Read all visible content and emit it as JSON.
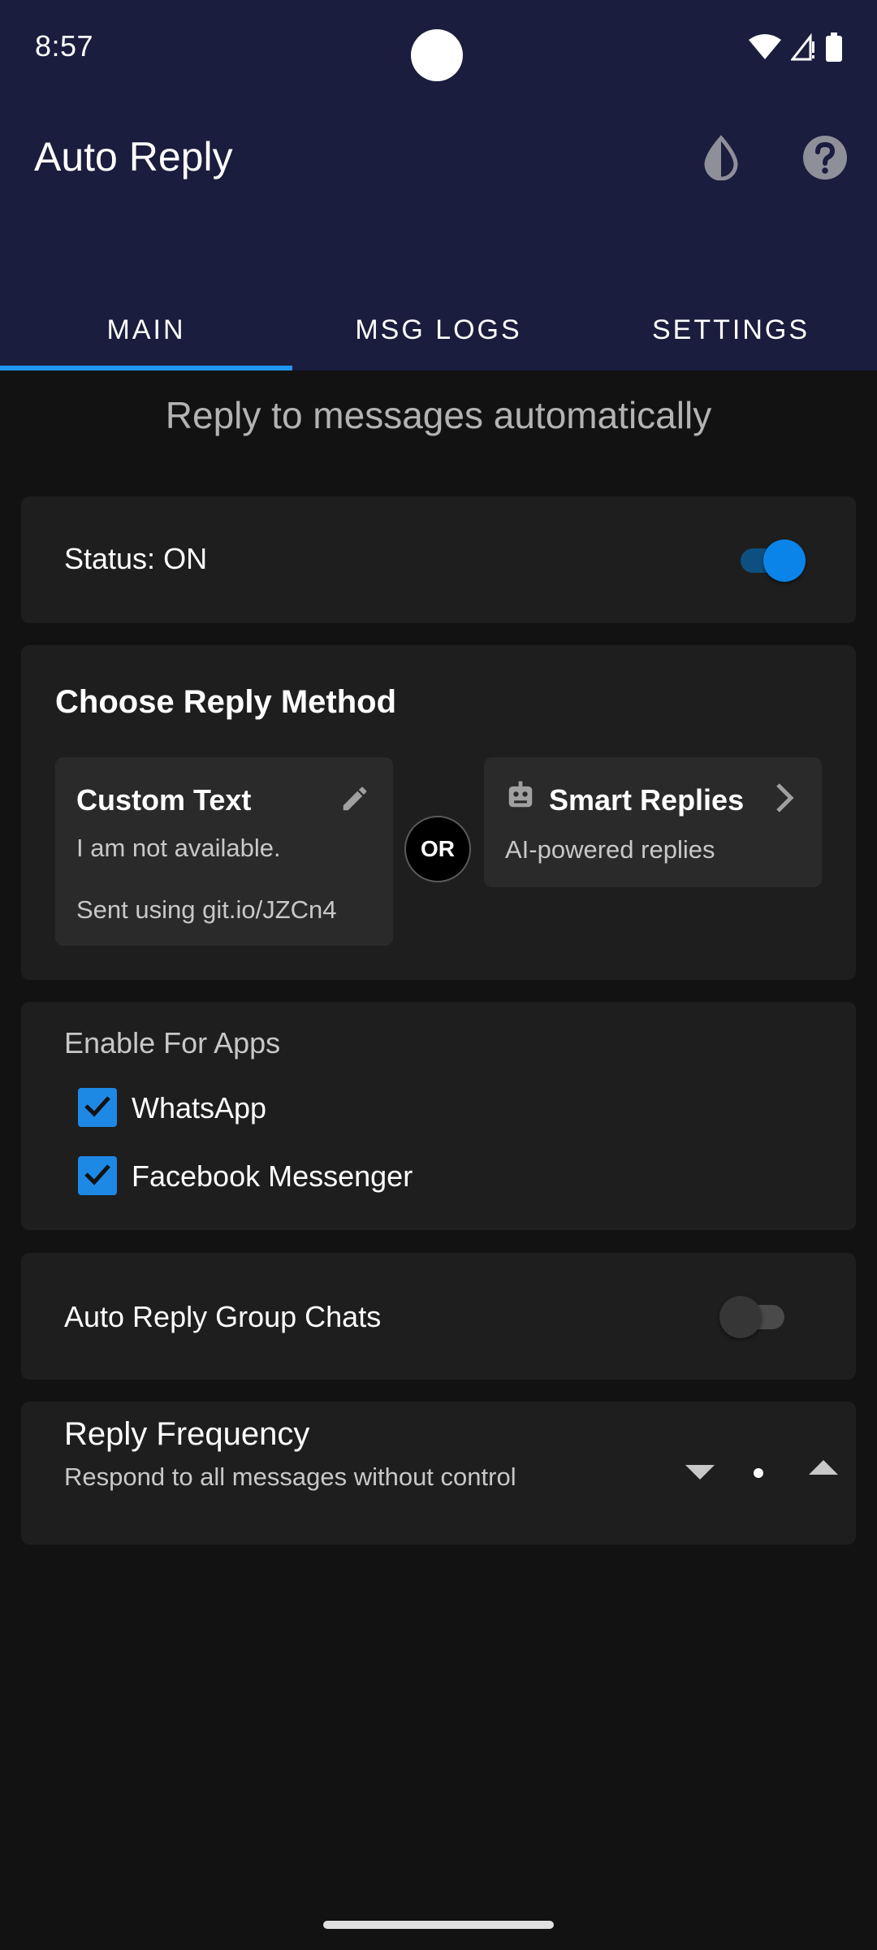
{
  "status_bar": {
    "time": "8:57",
    "icons": [
      "wifi-icon",
      "signal-icon",
      "battery-icon"
    ]
  },
  "app_bar": {
    "title": "Auto Reply",
    "actions": [
      "theme-contrast-icon",
      "help-icon"
    ]
  },
  "tabs": [
    {
      "label": "MAIN",
      "selected": true
    },
    {
      "label": "MSG LOGS",
      "selected": false
    },
    {
      "label": "SETTINGS",
      "selected": false
    }
  ],
  "main": {
    "subtitle": "Reply to messages automatically",
    "status": {
      "label": "Status: ON",
      "enabled": true
    },
    "reply_method": {
      "title": "Choose Reply Method",
      "custom_text": {
        "title": "Custom Text",
        "message": "I am not available.",
        "footer": "Sent using git.io/JZCn4",
        "icon": "edit-pencil-icon"
      },
      "or_label": "OR",
      "smart_replies": {
        "title": "Smart Replies",
        "description": "AI-powered replies",
        "icon": "robot-icon",
        "chevron": "chevron-right-icon"
      }
    },
    "enable_for_apps": {
      "header": "Enable For Apps",
      "apps": [
        {
          "label": "WhatsApp",
          "checked": true
        },
        {
          "label": "Facebook Messenger",
          "checked": true
        }
      ]
    },
    "group_chats": {
      "label": "Auto Reply Group Chats",
      "enabled": false
    },
    "reply_frequency": {
      "title": "Reply Frequency",
      "description": "Respond to all messages without control"
    }
  },
  "colors": {
    "app_bar": "#1a1d3d",
    "background": "#121212",
    "card": "#1e1e1e",
    "accent": "#2196f3",
    "switch_on_thumb": "#0a84e8",
    "switch_on_track": "#0d4f80",
    "switch_off_thumb": "#363636",
    "switch_off_track": "#4a4a4a",
    "checkbox": "#1e88e5"
  }
}
